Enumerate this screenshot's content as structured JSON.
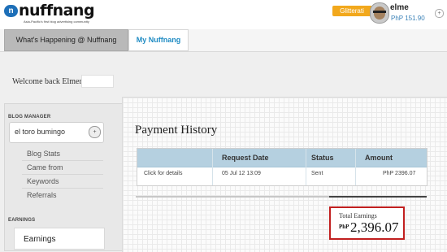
{
  "header": {
    "logo_text": "nuffnang",
    "logo_tagline": "Asia-Pacific's first blog advertising community",
    "glitterati_label": "Glitterati",
    "user_name": "elme",
    "user_balance": "PhP 151.90",
    "toggle_glyph": "+"
  },
  "tabs": [
    {
      "label": "What's Happening @ Nuffnang"
    },
    {
      "label": "My Nuffnang"
    }
  ],
  "welcome": {
    "text": "Welcome back Elmer"
  },
  "sidebar": {
    "blog_manager_heading": "BLOG MANAGER",
    "selected_blog": "el toro bumingo",
    "select_glyph": "+",
    "links": [
      "Blog Stats",
      "Came from",
      "Keywords",
      "Referrals"
    ],
    "earnings_heading": "EARNINGS",
    "earnings_item": "Earnings"
  },
  "main": {
    "title": "Payment History",
    "table": {
      "headers": [
        "",
        "Request Date",
        "Status",
        "Amount"
      ],
      "rows": [
        [
          "Click for details",
          "05 Jul 12 13:09",
          "Sent",
          "PhP 2396.07"
        ]
      ]
    },
    "total_earnings": {
      "label": "Total Earnings",
      "currency": "PhP",
      "amount": "2,396.07"
    }
  },
  "colors": {
    "accent_blue": "#1e8bc3",
    "glitterati_orange": "#f2a81c",
    "table_header": "#b5d0e0",
    "highlight_red": "#c11f1f"
  }
}
